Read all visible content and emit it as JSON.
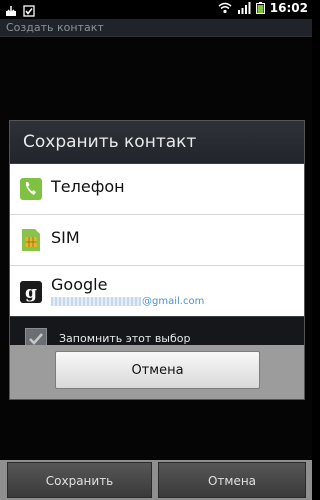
{
  "status_bar": {
    "time": "16:02"
  },
  "app": {
    "title": "Создать контакт"
  },
  "dialog": {
    "title": "Сохранить контакт",
    "options": [
      {
        "label": "Телефон",
        "icon": "phone-icon"
      },
      {
        "label": "SIM",
        "icon": "sim-icon"
      },
      {
        "label": "Google",
        "sublabel": "@gmail.com",
        "icon": "google-icon"
      }
    ],
    "remember_label": "Запомнить этот выбор",
    "remember_checked": true,
    "cancel_label": "Отмена"
  },
  "bottom_bar": {
    "save_label": "Сохранить",
    "cancel_label": "Отмена"
  },
  "colors": {
    "google_account": "#4a90d9",
    "phone_icon": "#7fc241",
    "sim_icon": "#8bc34a"
  }
}
